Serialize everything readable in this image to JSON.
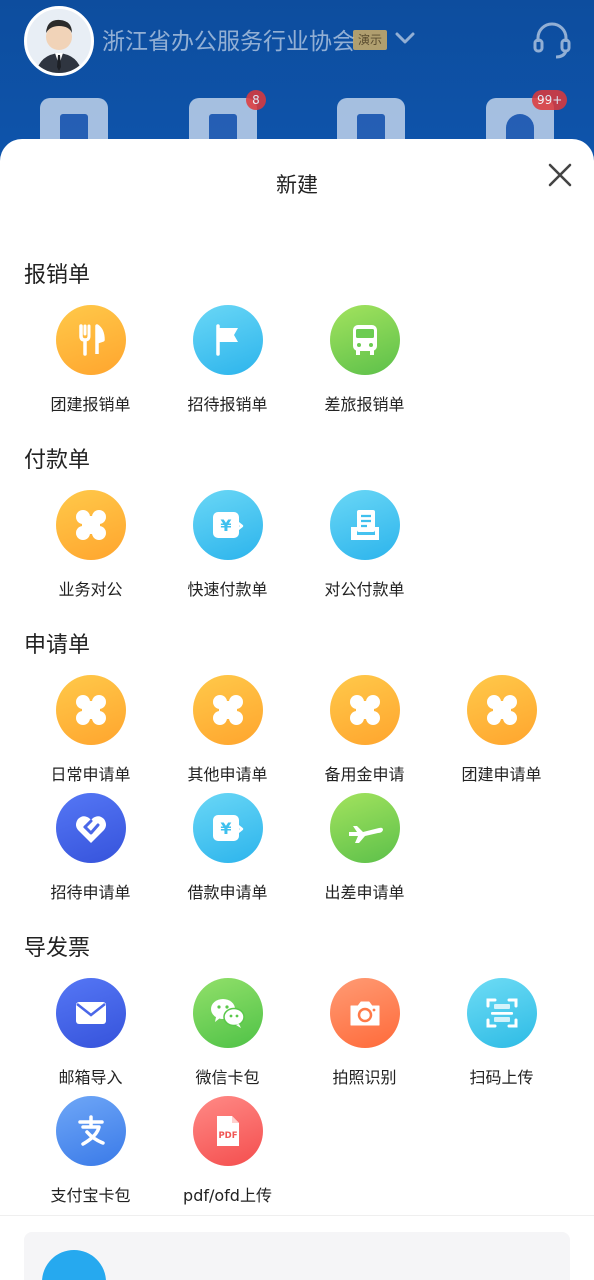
{
  "header": {
    "org_name": "浙江省办公服务行业协会",
    "demo_tag": "演示",
    "badges": [
      "8",
      "99+"
    ]
  },
  "sheet": {
    "title": "新建",
    "sections": [
      {
        "title": "报销单",
        "items": [
          {
            "label": "团建报销单",
            "icon": "fork-knife-icon",
            "color": "orange"
          },
          {
            "label": "招待报销单",
            "icon": "flag-icon",
            "color": "sky"
          },
          {
            "label": "差旅报销单",
            "icon": "bus-icon",
            "color": "green"
          }
        ]
      },
      {
        "title": "付款单",
        "items": [
          {
            "label": "业务对公",
            "icon": "clover-icon",
            "color": "orange"
          },
          {
            "label": "快速付款单",
            "icon": "yen-note-icon",
            "color": "sky"
          },
          {
            "label": "对公付款单",
            "icon": "document-tray-icon",
            "color": "sky"
          }
        ]
      },
      {
        "title": "申请单",
        "items": [
          {
            "label": "日常申请单",
            "icon": "clover-icon",
            "color": "orange"
          },
          {
            "label": "其他申请单",
            "icon": "clover-icon",
            "color": "orange"
          },
          {
            "label": "备用金申请",
            "icon": "clover-icon",
            "color": "orange"
          },
          {
            "label": "团建申请单",
            "icon": "clover-icon",
            "color": "orange"
          },
          {
            "label": "招待申请单",
            "icon": "handshake-heart-icon",
            "color": "indigo"
          },
          {
            "label": "借款申请单",
            "icon": "yen-note-icon",
            "color": "sky"
          },
          {
            "label": "出差申请单",
            "icon": "airplane-icon",
            "color": "green"
          }
        ]
      },
      {
        "title": "导发票",
        "items": [
          {
            "label": "邮箱导入",
            "icon": "mail-icon",
            "color": "indigo"
          },
          {
            "label": "微信卡包",
            "icon": "wechat-icon",
            "color": "wgreen"
          },
          {
            "label": "拍照识别",
            "icon": "camera-icon",
            "color": "coral"
          },
          {
            "label": "扫码上传",
            "icon": "scan-icon",
            "color": "cyan"
          },
          {
            "label": "支付宝卡包",
            "icon": "alipay-icon",
            "color": "blue"
          },
          {
            "label": "pdf/ofd上传",
            "icon": "pdf-file-icon",
            "color": "red"
          }
        ]
      }
    ]
  }
}
